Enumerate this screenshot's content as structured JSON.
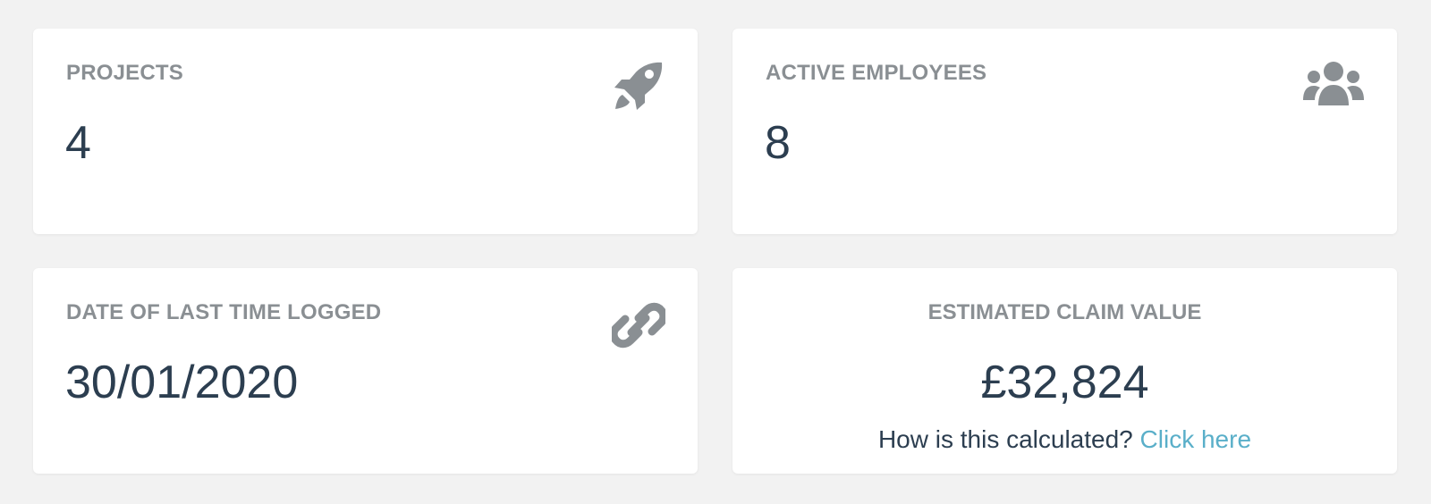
{
  "cards": {
    "projects": {
      "label": "PROJECTS",
      "value": "4",
      "icon": "rocket-icon"
    },
    "employees": {
      "label": "ACTIVE EMPLOYEES",
      "value": "8",
      "icon": "users-icon"
    },
    "last_logged": {
      "label": "DATE OF LAST TIME LOGGED",
      "value": "30/01/2020",
      "icon": "link-icon"
    },
    "claim": {
      "label": "ESTIMATED CLAIM VALUE",
      "value": "£32,824",
      "help_text": "How is this calculated?",
      "help_link": "Click here"
    }
  },
  "colors": {
    "label": "#8a8f93",
    "value": "#2c3e50",
    "icon": "#8a8f93",
    "link": "#5aafc9",
    "background": "#f2f2f2",
    "card": "#ffffff"
  }
}
